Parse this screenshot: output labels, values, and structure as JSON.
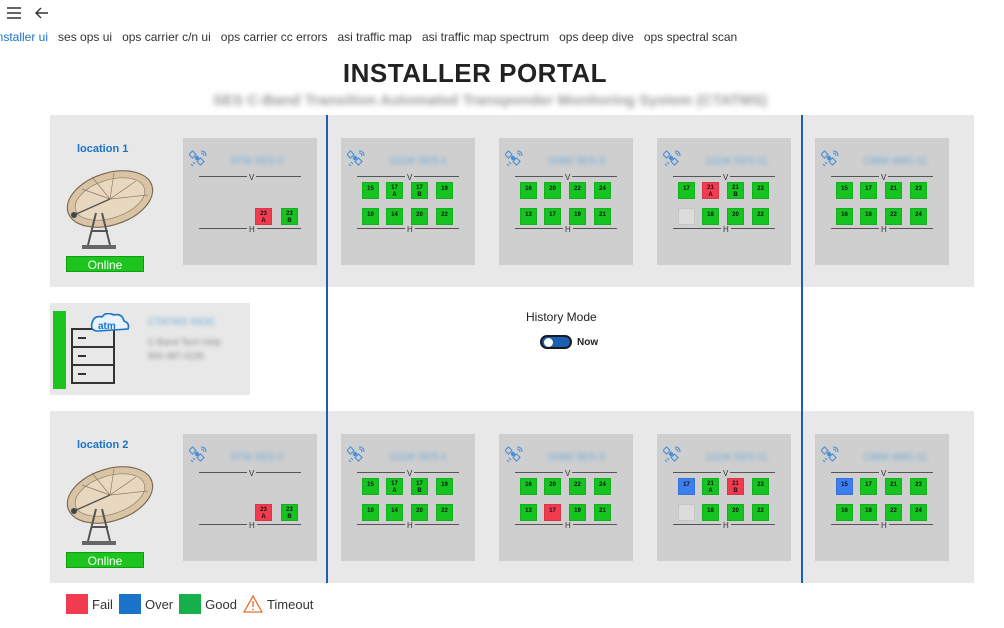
{
  "nav": {
    "menu_icon": "hamburger-menu-icon",
    "back_icon": "back-arrow-icon"
  },
  "tabs": [
    {
      "label": "installer ui",
      "active": true
    },
    {
      "label": "ses ops ui",
      "active": false
    },
    {
      "label": "ops carrier c/n ui",
      "active": false
    },
    {
      "label": "ops carrier cc errors",
      "active": false
    },
    {
      "label": "asi traffic map",
      "active": false
    },
    {
      "label": "asi traffic map spectrum",
      "active": false
    },
    {
      "label": "ops deep dive",
      "active": false
    },
    {
      "label": "ops spectral scan",
      "active": false
    }
  ],
  "header": {
    "title": "INSTALLER PORTAL",
    "subtitle": "SES C-Band Transition Automated Transponder Monitoring System (CTATMS)"
  },
  "locations": [
    {
      "label": "location 1",
      "status": "Online",
      "satellites": [
        {
          "name": "87W SES-2",
          "v": [],
          "h": [
            {
              "t": "23",
              "s": "A",
              "c": "r"
            },
            {
              "t": "23",
              "s": "B",
              "c": "g"
            }
          ]
        },
        {
          "name": "101W SES-1",
          "v": [
            {
              "t": "15",
              "c": "g"
            },
            {
              "t": "17",
              "s": "A",
              "c": "g"
            },
            {
              "t": "17",
              "s": "B",
              "c": "g"
            },
            {
              "t": "19",
              "c": "g"
            }
          ],
          "h": [
            {
              "t": "10",
              "c": "g"
            },
            {
              "t": "14",
              "c": "g"
            },
            {
              "t": "20",
              "c": "g"
            },
            {
              "t": "22",
              "c": "g"
            }
          ]
        },
        {
          "name": "103W SES-3",
          "v": [
            {
              "t": "16",
              "c": "g"
            },
            {
              "t": "20",
              "c": "g"
            },
            {
              "t": "22",
              "c": "g"
            },
            {
              "t": "24",
              "c": "g"
            }
          ],
          "h": [
            {
              "t": "13",
              "c": "g"
            },
            {
              "t": "17",
              "c": "g"
            },
            {
              "t": "19",
              "c": "g"
            },
            {
              "t": "21",
              "c": "g"
            }
          ]
        },
        {
          "name": "131W SES-11",
          "v": [
            {
              "t": "17",
              "c": "g"
            },
            {
              "t": "21",
              "s": "A",
              "c": "r"
            },
            {
              "t": "21",
              "s": "B",
              "c": "g"
            },
            {
              "t": "23",
              "c": "g"
            }
          ],
          "h": [
            {
              "t": "",
              "c": "x"
            },
            {
              "t": "18",
              "c": "g"
            },
            {
              "t": "20",
              "c": "g"
            },
            {
              "t": "22",
              "c": "g"
            }
          ]
        },
        {
          "name": "139W AMC-11",
          "v": [
            {
              "t": "15",
              "c": "g"
            },
            {
              "t": "17",
              "c": "g"
            },
            {
              "t": "21",
              "c": "g"
            },
            {
              "t": "23",
              "c": "g"
            }
          ],
          "h": [
            {
              "t": "16",
              "c": "g"
            },
            {
              "t": "18",
              "c": "g"
            },
            {
              "t": "22",
              "c": "g"
            },
            {
              "t": "24",
              "c": "g"
            }
          ]
        }
      ]
    },
    {
      "label": "location 2",
      "status": "Online",
      "satellites": [
        {
          "name": "87W SES-2",
          "v": [],
          "h": [
            {
              "t": "23",
              "s": "A",
              "c": "r"
            },
            {
              "t": "23",
              "s": "B",
              "c": "g"
            }
          ]
        },
        {
          "name": "101W SES-1",
          "v": [
            {
              "t": "15",
              "c": "g"
            },
            {
              "t": "17",
              "s": "A",
              "c": "g"
            },
            {
              "t": "17",
              "s": "B",
              "c": "g"
            },
            {
              "t": "19",
              "c": "g"
            }
          ],
          "h": [
            {
              "t": "10",
              "c": "g"
            },
            {
              "t": "14",
              "c": "g"
            },
            {
              "t": "20",
              "c": "g"
            },
            {
              "t": "22",
              "c": "g"
            }
          ]
        },
        {
          "name": "103W SES-3",
          "v": [
            {
              "t": "16",
              "c": "g"
            },
            {
              "t": "20",
              "c": "g"
            },
            {
              "t": "22",
              "c": "g"
            },
            {
              "t": "24",
              "c": "g"
            }
          ],
          "h": [
            {
              "t": "13",
              "c": "g"
            },
            {
              "t": "17",
              "c": "r"
            },
            {
              "t": "19",
              "c": "g"
            },
            {
              "t": "21",
              "c": "g"
            }
          ]
        },
        {
          "name": "131W SES-11",
          "v": [
            {
              "t": "17",
              "c": "b"
            },
            {
              "t": "21",
              "s": "A",
              "c": "g"
            },
            {
              "t": "21",
              "s": "B",
              "c": "r"
            },
            {
              "t": "23",
              "c": "g"
            }
          ],
          "h": [
            {
              "t": "",
              "c": "x"
            },
            {
              "t": "18",
              "c": "g"
            },
            {
              "t": "20",
              "c": "g"
            },
            {
              "t": "22",
              "c": "g"
            }
          ]
        },
        {
          "name": "139W AMC-11",
          "v": [
            {
              "t": "15",
              "c": "b"
            },
            {
              "t": "17",
              "c": "g"
            },
            {
              "t": "21",
              "c": "g"
            },
            {
              "t": "23",
              "c": "g"
            }
          ],
          "h": [
            {
              "t": "16",
              "c": "g"
            },
            {
              "t": "18",
              "c": "g"
            },
            {
              "t": "22",
              "c": "g"
            },
            {
              "t": "24",
              "c": "g"
            }
          ]
        }
      ]
    }
  ],
  "server": {
    "name": "CTATMS INOC",
    "line1": "C-Band Tech Help",
    "line2": "800-487-4195",
    "icon": "server-cloud-icon"
  },
  "history": {
    "label": "History Mode",
    "toggle_text": "Now"
  },
  "polarization": {
    "v": "V",
    "h": "H"
  },
  "legend": [
    {
      "label": "Fail",
      "color": "#f23b4e"
    },
    {
      "label": "Over",
      "color": "#1a73c8"
    },
    {
      "label": "Good",
      "color": "#16b04a"
    },
    {
      "label": "Timeout",
      "icon": "warning-triangle-icon"
    }
  ],
  "colors": {
    "good": "#16c421",
    "fail": "#f23b4e",
    "over": "#3d7ff0",
    "accent": "#1a73c8"
  }
}
